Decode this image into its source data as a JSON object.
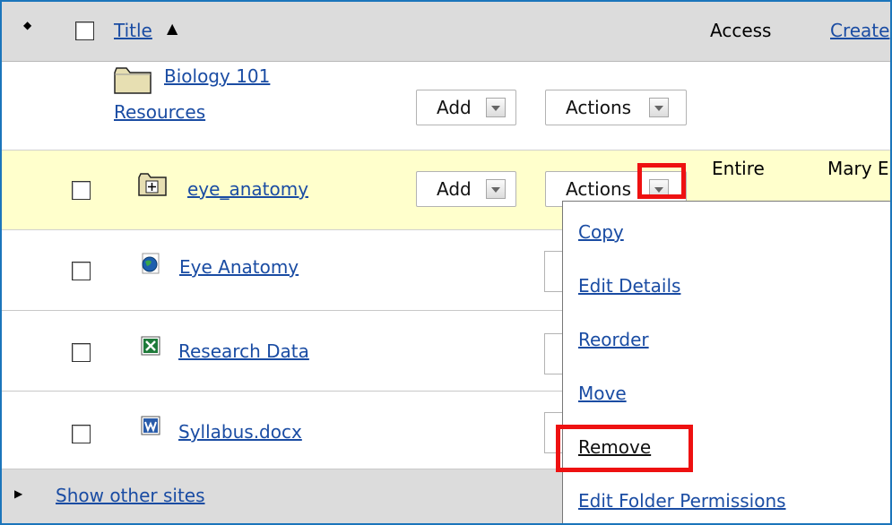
{
  "header": {
    "title_label": "Title",
    "access_label": "Access",
    "created_label": "Create"
  },
  "rows": [
    {
      "title_line1": "Biology 101",
      "title_line2": "Resources",
      "add_label": "Add",
      "actions_label": "Actions"
    },
    {
      "title": "eye_anatomy",
      "add_label": "Add",
      "actions_label": "Actions",
      "access": "Entire",
      "created_by": "Mary E"
    },
    {
      "title": "Eye Anatomy"
    },
    {
      "title": "Research Data"
    },
    {
      "title": "Syllabus.docx"
    }
  ],
  "actions_menu": {
    "items": [
      "Copy",
      "Edit Details",
      "Reorder",
      "Move",
      "Remove",
      "Edit Folder Permissions"
    ]
  },
  "footer": {
    "show_other_sites": "Show other sites"
  },
  "colors": {
    "frame": "#1b75bb",
    "highlight_row": "#ffffcc",
    "link": "#1a4ca3",
    "callout": "#ee1111"
  }
}
